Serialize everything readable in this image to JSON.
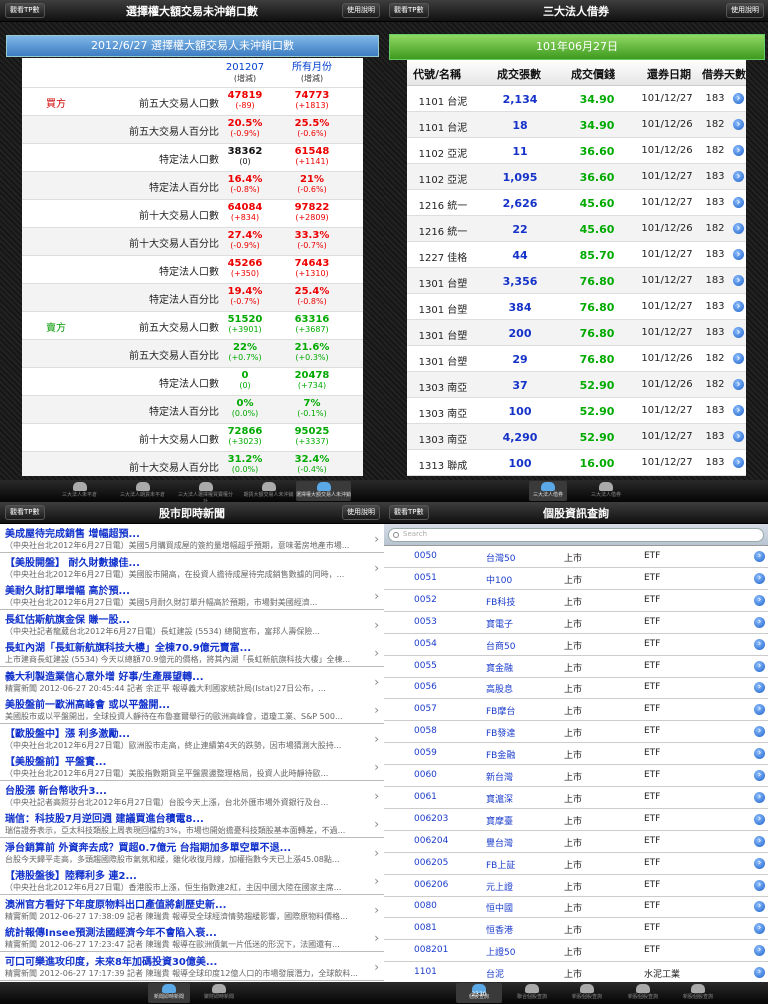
{
  "tl": {
    "left_btn": "觀看TP數",
    "right_btn": "使用說明",
    "title": "選擇權大額交易未沖銷口數",
    "banner": "2012/6/27 選擇權大額交易人未沖銷口數",
    "col1_a": "201207",
    "col1_b": "(增減)",
    "col2_a": "所有月份",
    "col2_b": "(增減)",
    "rows": [
      {
        "side": "買方",
        "label": "前五大交易人口數",
        "v1": "47819",
        "d1": "(-89)",
        "c1": "red",
        "v2": "74773",
        "d2": "(+1813)",
        "c2": "red"
      },
      {
        "side": "",
        "label": "前五大交易人百分比",
        "v1": "20.5%",
        "d1": "(-0.9%)",
        "c1": "red",
        "v2": "25.5%",
        "d2": "(-0.6%)",
        "c2": "red"
      },
      {
        "side": "",
        "label": "特定法人口數",
        "v1": "38362",
        "d1": "(0)",
        "c1": "blk",
        "v2": "61548",
        "d2": "(+1141)",
        "c2": "red"
      },
      {
        "side": "",
        "label": "特定法人百分比",
        "v1": "16.4%",
        "d1": "(-0.8%)",
        "c1": "red",
        "v2": "21%",
        "d2": "(-0.6%)",
        "c2": "red"
      },
      {
        "side": "",
        "label": "前十大交易人口數",
        "v1": "64084",
        "d1": "(+834)",
        "c1": "red",
        "v2": "97822",
        "d2": "(+2809)",
        "c2": "red"
      },
      {
        "side": "",
        "label": "前十大交易人百分比",
        "v1": "27.4%",
        "d1": "(-0.9%)",
        "c1": "red",
        "v2": "33.3%",
        "d2": "(-0.7%)",
        "c2": "red"
      },
      {
        "side": "",
        "label": "特定法人口數",
        "v1": "45266",
        "d1": "(+350)",
        "c1": "red",
        "v2": "74643",
        "d2": "(+1310)",
        "c2": "red"
      },
      {
        "side": "",
        "label": "特定法人百分比",
        "v1": "19.4%",
        "d1": "(-0.7%)",
        "c1": "red",
        "v2": "25.4%",
        "d2": "(-0.8%)",
        "c2": "red"
      },
      {
        "side": "賣方",
        "label": "前五大交易人口數",
        "v1": "51520",
        "d1": "(+3901)",
        "c1": "grn",
        "v2": "63316",
        "d2": "(+3687)",
        "c2": "grn"
      },
      {
        "side": "",
        "label": "前五大交易人百分比",
        "v1": "22%",
        "d1": "(+0.7%)",
        "c1": "grn",
        "v2": "21.6%",
        "d2": "(+0.3%)",
        "c2": "grn"
      },
      {
        "side": "",
        "label": "特定法人口數",
        "v1": "0",
        "d1": "(0)",
        "c1": "grn",
        "v2": "20478",
        "d2": "(+734)",
        "c2": "grn"
      },
      {
        "side": "",
        "label": "特定法人百分比",
        "v1": "0%",
        "d1": "(0.0%)",
        "c1": "grn",
        "v2": "7%",
        "d2": "(-0.1%)",
        "c2": "grn"
      },
      {
        "side": "",
        "label": "前十大交易人口數",
        "v1": "72866",
        "d1": "(+3023)",
        "c1": "grn",
        "v2": "95025",
        "d2": "(+3337)",
        "c2": "grn"
      },
      {
        "side": "",
        "label": "前十大交易人百分比",
        "v1": "31.2%",
        "d1": "(0.0%)",
        "c1": "grn",
        "v2": "32.4%",
        "d2": "(-0.4%)",
        "c2": "grn"
      }
    ],
    "tabs": [
      "三大法人未平倉",
      "三大法人期貨未平倉",
      "三大法人選擇權買賣權分計",
      "期貨大額交易人未沖銷",
      "選擇權大額交易人未沖銷"
    ]
  },
  "tr": {
    "left_btn": "觀看TP數",
    "right_btn": "使用說明",
    "title": "三大法人借券",
    "banner": "101年06月27日",
    "headers": [
      "代號/名稱",
      "成交張數",
      "成交價錢",
      "還券日期",
      "借券天數"
    ],
    "rows": [
      [
        "1101 台泥",
        "2,134",
        "34.90",
        "101/12/27",
        "183"
      ],
      [
        "1101 台泥",
        "18",
        "34.90",
        "101/12/26",
        "182"
      ],
      [
        "1102 亞泥",
        "11",
        "36.60",
        "101/12/26",
        "182"
      ],
      [
        "1102 亞泥",
        "1,095",
        "36.60",
        "101/12/27",
        "183"
      ],
      [
        "1216 統一",
        "2,626",
        "45.60",
        "101/12/27",
        "183"
      ],
      [
        "1216 統一",
        "22",
        "45.60",
        "101/12/26",
        "182"
      ],
      [
        "1227 佳格",
        "44",
        "85.70",
        "101/12/27",
        "183"
      ],
      [
        "1301 台塑",
        "3,356",
        "76.80",
        "101/12/27",
        "183"
      ],
      [
        "1301 台塑",
        "384",
        "76.80",
        "101/12/27",
        "183"
      ],
      [
        "1301 台塑",
        "200",
        "76.80",
        "101/12/27",
        "183"
      ],
      [
        "1301 台塑",
        "29",
        "76.80",
        "101/12/26",
        "182"
      ],
      [
        "1303 南亞",
        "37",
        "52.90",
        "101/12/26",
        "182"
      ],
      [
        "1303 南亞",
        "100",
        "52.90",
        "101/12/27",
        "183"
      ],
      [
        "1303 南亞",
        "4,290",
        "52.90",
        "101/12/27",
        "183"
      ],
      [
        "1313 聯成",
        "100",
        "16.00",
        "101/12/27",
        "183"
      ]
    ],
    "tabs": [
      "三大法人借券",
      "三大法人借券"
    ]
  },
  "bl": {
    "left_btn": "觀看TP數",
    "right_btn": "使用說明",
    "title": "股市即時新聞",
    "news": [
      {
        "h": "美成屋待完成銷售 增幅超預...",
        "s": "（中央社台北2012年6月27日電）美國5月購買成屋的簽約量增幅超乎預期，意味著房地產市場..."
      },
      {
        "h": "【美股開盤】 耐久財數據佳...",
        "s": "（中央社台北2012年6月27日電）美國股市開高，在投資人擔待成屋待完成銷售數據的同時，..."
      },
      {
        "h": "美耐久財訂單增幅 高於預...",
        "s": "（中央社台北2012年6月27日電）美國5月耐久財訂單升幅高於預期，市場對美國經濟..."
      },
      {
        "h": "長紅估斯航旗金保 賺一股...",
        "s": "（中央社記者龍葳台北2012年6月27日電）長虹建設 (5534) 總間宣布，富邦人壽保險..."
      },
      {
        "h": "長虹內湖「長虹新航旗科技大樓」全棟70.9億元賣富...",
        "s": "上市建商長虹建設 (5534) 今天以總額70.9億元的價格，將其內湖「長虹新航旗科技大樓」全棟..."
      },
      {
        "h": "義大利製造業信心意外增 好事/生產展望轉...",
        "s": "精實新聞 2012-06-27 20:45:44 記者 余正平 報導義大利國家統計局(Istat)27日公布，..."
      },
      {
        "h": "美股盤前一歐洲高峰會 或以平盤開...",
        "s": "美國股市或以平盤開出，全球投資人靜待在布魯塞爾舉行的歐洲高峰會，道瓊工業、S&P 500..."
      },
      {
        "h": "【歐股盤中】漲 利多激勵...",
        "s": "（中央社台北2012年6月27日電）歐洲股市走高，終止連續第4天的跌勢，因市場猜測大股持..."
      },
      {
        "h": "【美股盤前】平盤實...",
        "s": "（中央社台北2012年6月27日電）美股指數期貨呈平盤震盪整理格局，投資人此時靜待歐..."
      },
      {
        "h": "台股漲 新台幣收升3...",
        "s": "（中央社記者高照芬台北2012年6月27日電）台股今天上漲，台北外匯市場外資銀行及台..."
      },
      {
        "h": "瑞信：科技股7月逆回週 建議買進台積電8...",
        "s": "瑞信證券表示，亞太科技類股上周表現回檔約3%，市場也開始擔憂科技類股基本面轉差，不過..."
      },
      {
        "h": "淨台銷算前 外資奔去成？買超0.7億元 台指期加多單空單不退...",
        "s": "台股今天歸平走高，多頭趨國際股市氣氛和緩，雖化收復月線，加權指數今天已上漲45.08點..."
      },
      {
        "h": "【港股盤後】陸釋利多 連2...",
        "s": "（中央社台北2012年6月27日電）香港股市上漲，恒生指數連2紅，主因中國大陸在國家主席..."
      },
      {
        "h": "澳洲官方看好下年度原物料出口產值將創歷史新...",
        "s": "精實新聞 2012-06-27 17:38:09 記者 陳瑞貴 報導受全球經濟情勢趨緩影響，國際原物料價格..."
      },
      {
        "h": "統計報傳Insee預測法國經濟今年不會陷入衰...",
        "s": "精實新聞 2012-06-27 17:23:47 記者 陳瑞貴 報導在歐洲債氣一片低迷的形況下，法國還有..."
      },
      {
        "h": "可口可樂進攻印度，未來8年加碼投資30億美...",
        "s": "精實新聞 2012-06-27 17:17:39 記者 陳瑞貴 報導全球印度12億人口的市場發展潛力，全球飲料..."
      }
    ],
    "tabs": [
      "新聞即時新聞",
      "聚財即時新聞"
    ]
  },
  "br": {
    "left_btn": "觀看TP數",
    "right_btn": "使用說明",
    "title": "個股資訊查詢",
    "search_placeholder": "Search",
    "rows": [
      [
        "0050",
        "台灣50",
        "上市",
        "ETF"
      ],
      [
        "0051",
        "中100",
        "上市",
        "ETF"
      ],
      [
        "0052",
        "FB科技",
        "上市",
        "ETF"
      ],
      [
        "0053",
        "寶電子",
        "上市",
        "ETF"
      ],
      [
        "0054",
        "台商50",
        "上市",
        "ETF"
      ],
      [
        "0055",
        "寶金融",
        "上市",
        "ETF"
      ],
      [
        "0056",
        "高股息",
        "上市",
        "ETF"
      ],
      [
        "0057",
        "FB摩台",
        "上市",
        "ETF"
      ],
      [
        "0058",
        "FB發達",
        "上市",
        "ETF"
      ],
      [
        "0059",
        "FB金融",
        "上市",
        "ETF"
      ],
      [
        "0060",
        "新台灣",
        "上市",
        "ETF"
      ],
      [
        "0061",
        "寶滬深",
        "上市",
        "ETF"
      ],
      [
        "006203",
        "寶摩臺",
        "上市",
        "ETF"
      ],
      [
        "006204",
        "豐台灣",
        "上市",
        "ETF"
      ],
      [
        "006205",
        "FB上証",
        "上市",
        "ETF"
      ],
      [
        "006206",
        "元上證",
        "上市",
        "ETF"
      ],
      [
        "0080",
        "恒中國",
        "上市",
        "ETF"
      ],
      [
        "0081",
        "恒香港",
        "上市",
        "ETF"
      ],
      [
        "008201",
        "上證50",
        "上市",
        "ETF"
      ],
      [
        "1101",
        "台泥",
        "上市",
        "水泥工業"
      ]
    ],
    "tabs": [
      "個股查詢",
      "聯合個股查詢",
      "新股個股查詢",
      "新股個股查詢",
      "新股個股查詢"
    ],
    "tab_badge": "2330"
  },
  "colors": {
    "buy": "#e00000",
    "sell": "#00aa00",
    "link": "#1132cc",
    "banner_blue": "#3d7cc2",
    "banner_green": "#3e9a1e"
  }
}
